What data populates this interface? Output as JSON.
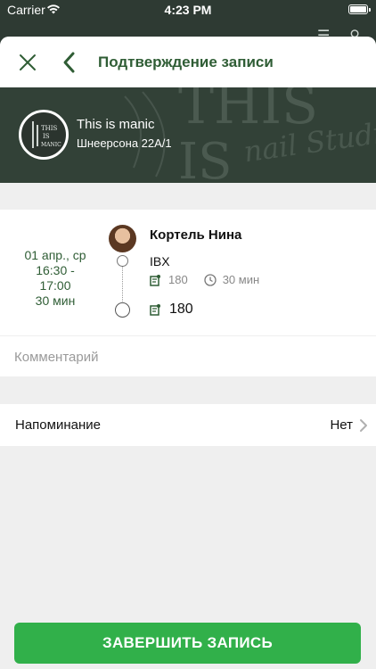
{
  "status_bar": {
    "carrier": "Carrier",
    "time": "4:23 PM"
  },
  "nav": {
    "title": "Подтверждение записи"
  },
  "salon": {
    "name": "This is manic",
    "address": "Шнеерсона 22А/1",
    "logo_text": "THIS IS MANIC"
  },
  "appointment": {
    "date": "01 апр., ср",
    "time_range": "16:30 -\n17:00",
    "duration": "30 мин",
    "master": "Кортель Нина",
    "service": "IBX",
    "service_price": "180",
    "service_duration": "30 мин",
    "total": "180"
  },
  "comment": {
    "placeholder": "Комментарий",
    "value": ""
  },
  "reminder": {
    "label": "Напоминание",
    "value": "Нет"
  },
  "finish_button": {
    "label": "ЗАВЕРШИТЬ ЗАПИСЬ"
  },
  "colors": {
    "accent": "#2f5d35",
    "button": "#31b04a",
    "header_bg": "#324137"
  },
  "icons": [
    "close-icon",
    "back-chevron-icon",
    "wallet-icon",
    "clock-icon",
    "chevron-right-icon"
  ]
}
